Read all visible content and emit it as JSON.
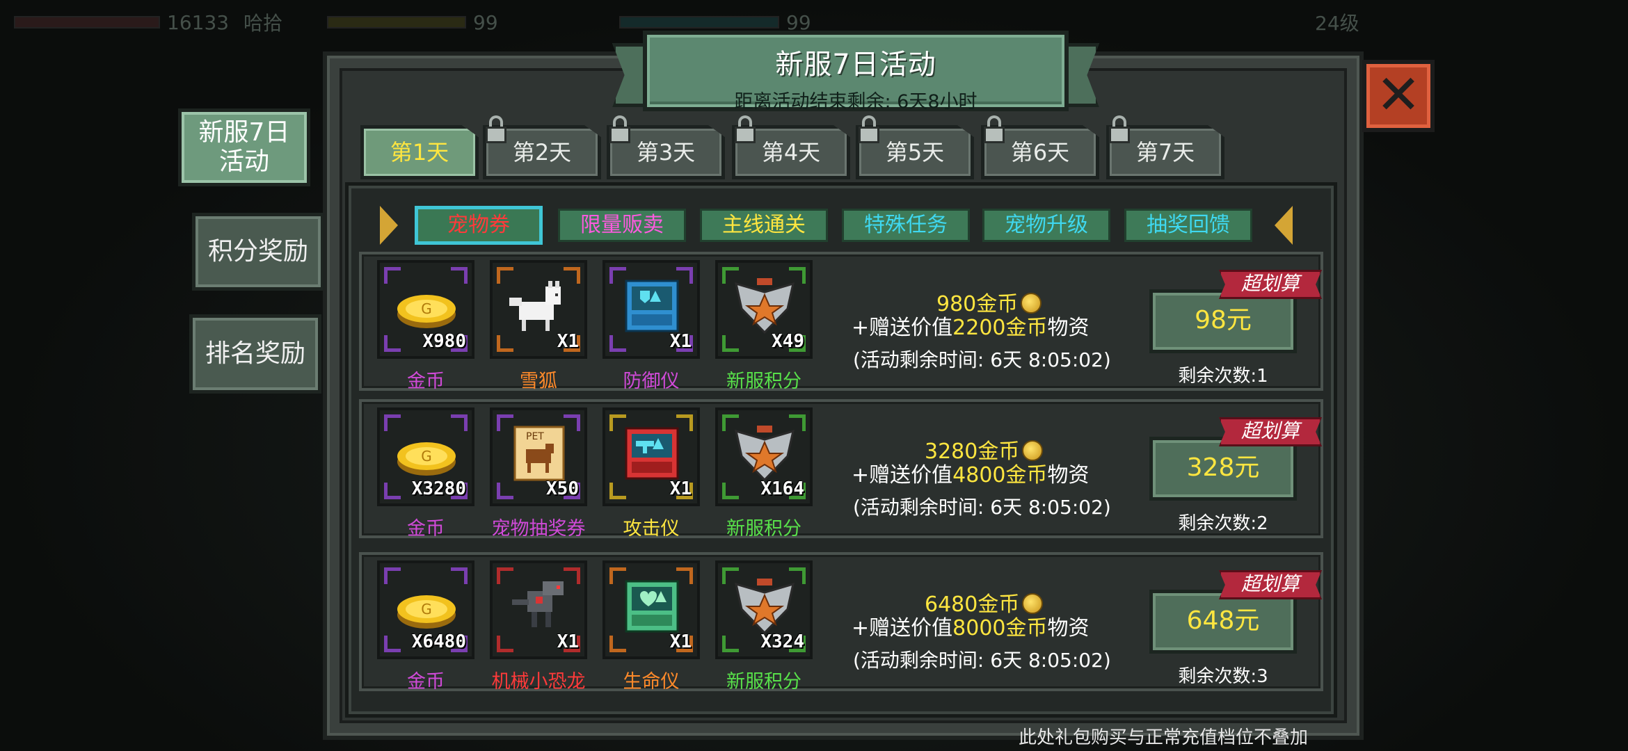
{
  "hud": {
    "hp": "16133",
    "name": "哈拾",
    "level_value": "99",
    "exp_value": "99",
    "player_level": "24级"
  },
  "title": {
    "main": "新服7日活动",
    "sub": "距离活动结束剩余: 6天8小时"
  },
  "close_icon": "close-icon",
  "side_nav": [
    {
      "label_line1": "新服7日",
      "label_line2": "活动"
    },
    {
      "label": "积分奖励"
    },
    {
      "label": "排名奖励"
    }
  ],
  "day_tabs": [
    "第1天",
    "第2天",
    "第3天",
    "第4天",
    "第5天",
    "第6天",
    "第7天"
  ],
  "categories": [
    {
      "label": "宠物券",
      "color": "#ff3a3a"
    },
    {
      "label": "限量贩卖",
      "color": "#ff5adf"
    },
    {
      "label": "主线通关",
      "color": "#ffe640"
    },
    {
      "label": "特殊任务",
      "color": "#3fd8f0"
    },
    {
      "label": "宠物升级",
      "color": "#3fd8f0"
    },
    {
      "label": "抽奖回馈",
      "color": "#3fd8f0"
    }
  ],
  "offers": [
    {
      "items": [
        {
          "name": "金币",
          "qty": "X980",
          "name_color": "#d04ad8",
          "frame": "#7a3fb0",
          "icon": "gold-coin-icon"
        },
        {
          "name": "雪狐",
          "qty": "X1",
          "name_color": "#ff8a2a",
          "frame": "#c0671e",
          "icon": "snow-fox-icon"
        },
        {
          "name": "防御仪",
          "qty": "X1",
          "name_color": "#d04ad8",
          "frame": "#7a3fb0",
          "icon": "defense-device-icon"
        },
        {
          "name": "新服积分",
          "qty": "X49",
          "name_color": "#58e04a",
          "frame": "#3f9a34",
          "icon": "server-points-icon"
        }
      ],
      "coins": "980金币",
      "bonus_prefix": "+赠送价值",
      "bonus_value": "2200金币",
      "bonus_suffix": "物资",
      "time": "(活动剩余时间: 6天 8:05:02)",
      "tag": "超划算",
      "price": "98元",
      "remaining": "剩余次数:1"
    },
    {
      "items": [
        {
          "name": "金币",
          "qty": "X3280",
          "name_color": "#d04ad8",
          "frame": "#7a3fb0",
          "icon": "gold-coin-icon"
        },
        {
          "name": "宠物抽奖券",
          "qty": "X50",
          "name_color": "#d04ad8",
          "frame": "#7a3fb0",
          "icon": "pet-ticket-icon"
        },
        {
          "name": "攻击仪",
          "qty": "X1",
          "name_color": "#ffe640",
          "frame": "#b89a20",
          "icon": "attack-device-icon"
        },
        {
          "name": "新服积分",
          "qty": "X164",
          "name_color": "#58e04a",
          "frame": "#3f9a34",
          "icon": "server-points-icon"
        }
      ],
      "coins": "3280金币",
      "bonus_prefix": "+赠送价值",
      "bonus_value": "4800金币",
      "bonus_suffix": "物资",
      "time": "(活动剩余时间: 6天 8:05:02)",
      "tag": "超划算",
      "price": "328元",
      "remaining": "剩余次数:2"
    },
    {
      "items": [
        {
          "name": "金币",
          "qty": "X6480",
          "name_color": "#d04ad8",
          "frame": "#7a3fb0",
          "icon": "gold-coin-icon"
        },
        {
          "name": "机械小恐龙",
          "qty": "X1",
          "name_color": "#ff3a3a",
          "frame": "#b02c2c",
          "icon": "mech-dino-icon"
        },
        {
          "name": "生命仪",
          "qty": "X1",
          "name_color": "#ff8a2a",
          "frame": "#c0671e",
          "icon": "life-device-icon"
        },
        {
          "name": "新服积分",
          "qty": "X324",
          "name_color": "#58e04a",
          "frame": "#3f9a34",
          "icon": "server-points-icon"
        }
      ],
      "coins": "6480金币",
      "bonus_prefix": "+赠送价值",
      "bonus_value": "8000金币",
      "bonus_suffix": "物资",
      "time": "(活动剩余时间: 6天 8:05:02)",
      "tag": "超划算",
      "price": "648元",
      "remaining": "剩余次数:3"
    }
  ],
  "footer_note": "此处礼包购买与正常充值档位不叠加"
}
